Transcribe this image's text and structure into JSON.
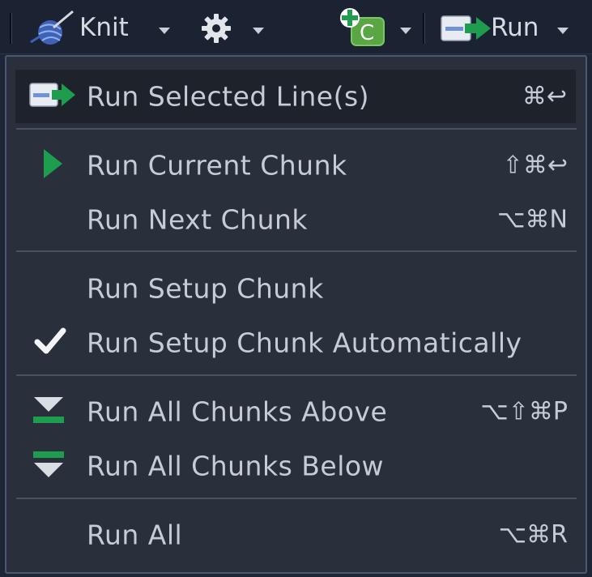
{
  "toolbar": {
    "knit_label": "Knit",
    "run_label": "Run",
    "insert_chunk_letter": "C"
  },
  "menu": {
    "run_selected": {
      "label": "Run Selected Line(s)",
      "shortcut": "⌘↩"
    },
    "run_current_chunk": {
      "label": "Run Current Chunk",
      "shortcut": "⇧⌘↩"
    },
    "run_next_chunk": {
      "label": "Run Next Chunk",
      "shortcut": "⌥⌘N"
    },
    "run_setup_chunk": {
      "label": "Run Setup Chunk"
    },
    "run_setup_auto": {
      "label": "Run Setup Chunk Automatically",
      "checked": true
    },
    "run_all_above": {
      "label": "Run All Chunks Above",
      "shortcut": "⌥⇧⌘P"
    },
    "run_all_below": {
      "label": "Run All Chunks Below"
    },
    "run_all": {
      "label": "Run All",
      "shortcut": "⌥⌘R"
    }
  },
  "colors": {
    "accent_green": "#1f9d4e",
    "menu_bg": "#2a303b",
    "toolbar_bg": "#1b2232",
    "text": "#c6ccd6"
  },
  "icons": {
    "knit": "knit-yarn-icon",
    "settings": "gear-icon",
    "insert_chunk": "insert-chunk-icon",
    "run": "run-arrow-icon",
    "current_chunk": "play-triangle-icon",
    "checked": "checkmark-icon",
    "above": "run-above-icon",
    "below": "run-below-icon"
  }
}
